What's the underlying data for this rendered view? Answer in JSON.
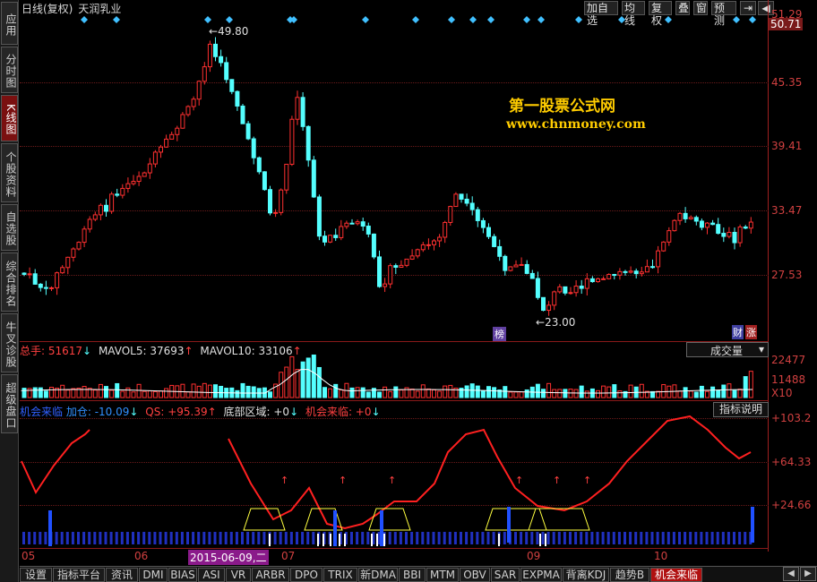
{
  "left_nav": [
    "应用",
    "分时图",
    "K线图",
    "个股资料",
    "自选股",
    "综合排名",
    "牛叉诊股",
    "超级盘口"
  ],
  "left_nav_active": 2,
  "top_bar": {
    "chart_type": "日线(复权)",
    "stock_name": "天润乳业",
    "buttons": [
      "加自选",
      "均线",
      "复权",
      "叠",
      "窗",
      "预测"
    ],
    "nav_glyphs": [
      "⇥",
      "◀"
    ]
  },
  "price_axis": [
    "51.29",
    "50.71",
    "45.35",
    "39.41",
    "33.47",
    "27.53"
  ],
  "annotations": {
    "high": "49.80",
    "low": "23.00",
    "badge_bang": "榜",
    "badge_cai": "财",
    "badge_zhang": "涨",
    "watermark_title": "第一股票公式网",
    "watermark_url": "www.chnmoney.com"
  },
  "volume": {
    "label_total": "总手: 51617",
    "label_mavol5": "MAVOL5: 37693",
    "label_mavol10": "MAVOL10: 33106",
    "dropdown": "成交量",
    "axis": [
      "22477",
      "11488",
      "X10"
    ]
  },
  "indicator": {
    "name": "机会来临",
    "label_jiacang": "加仓: -10.09",
    "label_qs": "QS: +95.39",
    "label_dibu": "底部区域: +0",
    "label_jihui": "机会来临: +0",
    "button": "指标说明",
    "axis": [
      "+103.2",
      "+64.33",
      "+24.66"
    ]
  },
  "date_axis": [
    "05",
    "06",
    "07",
    "09",
    "10"
  ],
  "date_highlight": "2015-06-09,二",
  "tabs": [
    "设置",
    "指标平台",
    "资讯",
    "DMI",
    "BIAS",
    "ASI",
    "VR",
    "ARBR",
    "DPO",
    "TRIX",
    "新DMA",
    "BBI",
    "MTM",
    "OBV",
    "SAR",
    "EXPMA",
    "背离KDJ",
    "趋势B",
    "机会来临"
  ],
  "tabs_active": 18,
  "colors": {
    "up": "#ff3030",
    "down": "#54ffff",
    "axis": "#a02020",
    "accent_gold": "#ffcc00",
    "signal_blue": "#3090ff",
    "ma_yellow": "#ffff40"
  }
}
